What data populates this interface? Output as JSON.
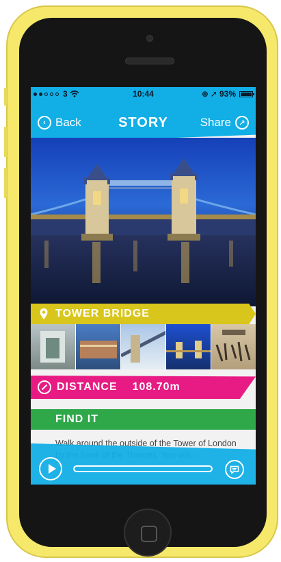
{
  "status_bar": {
    "carrier": "3",
    "time": "10:44",
    "battery_text": "93%"
  },
  "nav": {
    "back_label": "Back",
    "title": "STORY",
    "share_label": "Share"
  },
  "location": {
    "name": "TOWER BRIDGE"
  },
  "distance": {
    "label": "DISTANCE",
    "value": "108.70m"
  },
  "find_it": {
    "heading": "FIND IT",
    "text": "Walk around the outside of the Tower of London by the bank of the Thames. You will..."
  },
  "thumbnails": [
    "bridge-walkway-photo",
    "bridge-side-photo",
    "bridge-angle-photo",
    "bridge-night-photo",
    "album-cover-photo"
  ],
  "player": {
    "progress": 0.0
  },
  "colors": {
    "nav_blue": "#12aee6",
    "title_yellow": "#d8c61c",
    "distance_pink": "#e71b83",
    "find_green": "#2fa84a",
    "phone_yellow": "#f6e86a"
  }
}
